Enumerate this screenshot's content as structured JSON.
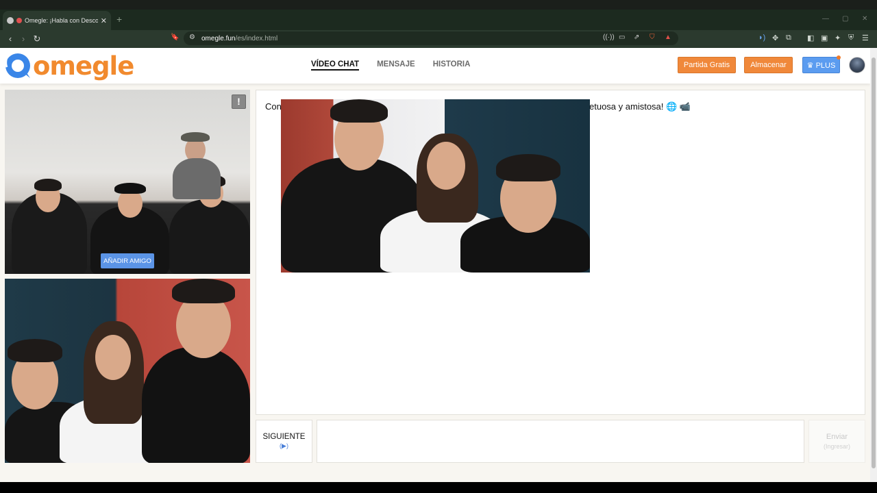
{
  "browser": {
    "tab_title": "Omegle: ¡Habla con Descono",
    "tab_close": "✕",
    "new_tab": "+",
    "url_host": "omegle.fun",
    "url_path": "/es/index.html"
  },
  "header": {
    "logo_text": "omegle",
    "nav": [
      {
        "label": "VÍDEO CHAT",
        "active": true
      },
      {
        "label": "MENSAJE",
        "active": false
      },
      {
        "label": "HISTORIA",
        "active": false
      }
    ],
    "btn_free_game": "Partida Gratis",
    "btn_store": "Almacenar",
    "btn_plus": "♛ PLUS"
  },
  "video": {
    "report_label": "!",
    "add_friend_label": "AÑADIR AMIGO"
  },
  "chat": {
    "message_left": "Con",
    "message_right": "etuosa y amistosa! 🌐 📹"
  },
  "controls": {
    "next_label": "SIGUIENTE",
    "next_hint": "(▶)",
    "send_label": "Enviar",
    "send_hint": "(Ingresar)"
  },
  "colors": {
    "brand_orange": "#f18a2e",
    "brand_blue": "#3a86e8",
    "plus_blue": "#5b9cf0"
  }
}
